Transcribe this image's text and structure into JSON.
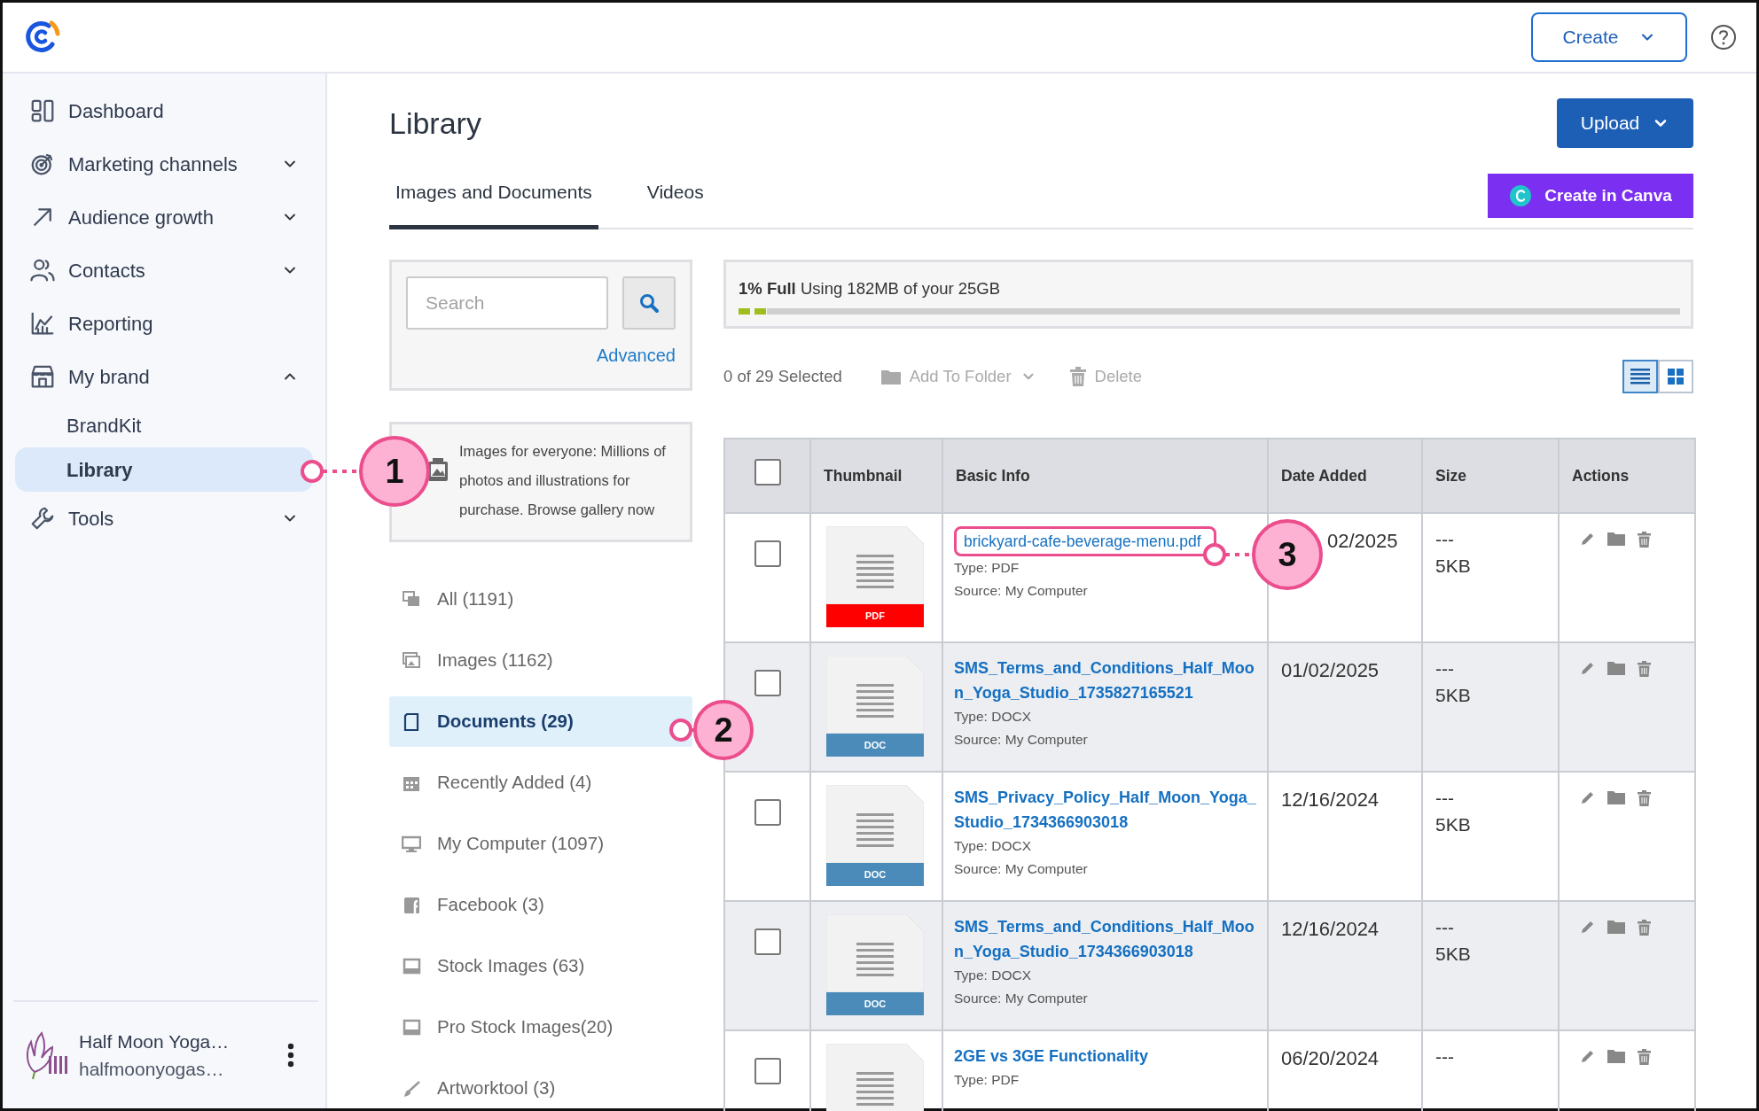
{
  "header": {
    "create_button": "Create"
  },
  "sidebar": {
    "items": [
      {
        "label": "Dashboard",
        "selected": false
      },
      {
        "label": "Marketing channels",
        "expanded": false,
        "selected": false
      },
      {
        "label": "Audience growth",
        "expanded": false,
        "selected": false
      },
      {
        "label": "Contacts",
        "expanded": false,
        "selected": false
      },
      {
        "label": "Reporting",
        "selected": false
      },
      {
        "label": "My brand",
        "expanded": true,
        "selected": false,
        "children": [
          {
            "label": "BrandKit",
            "selected": false
          },
          {
            "label": "Library",
            "selected": true
          }
        ]
      },
      {
        "label": "Tools",
        "expanded": false,
        "selected": false
      }
    ],
    "account": {
      "name": "Half Moon Yoga…",
      "email": "halfmoonyogas…"
    }
  },
  "page": {
    "title": "Library",
    "upload_button": "Upload",
    "canva_button": "Create in Canva",
    "tabs": [
      {
        "label": "Images and Documents",
        "selected": true
      },
      {
        "label": "Videos",
        "selected": false
      }
    ]
  },
  "search": {
    "placeholder": "Search",
    "advanced_link": "Advanced"
  },
  "promo": {
    "text": "Images for everyone: Millions of photos and illustrations for purchase.",
    "link": "Browse gallery now"
  },
  "filters": [
    {
      "label": "All (1191)",
      "selected": false
    },
    {
      "label": "Images (1162)",
      "selected": false
    },
    {
      "label": "Documents (29)",
      "selected": true
    },
    {
      "label": "Recently Added (4)",
      "selected": false
    },
    {
      "label": "My Computer (1097)",
      "selected": false
    },
    {
      "label": "Facebook (3)",
      "selected": false
    },
    {
      "label": "Stock Images (63)",
      "selected": false
    },
    {
      "label": "Pro Stock Images(20)",
      "selected": false
    },
    {
      "label": "Artworktool (3)",
      "selected": false
    }
  ],
  "storage": {
    "text": "**1% Full** Using 182MB of your 25GB",
    "level": 0.03
  },
  "toolbar": {
    "selected_count": "0 of 29 Selected",
    "add_to_folder": "Add To Folder",
    "delete": "Delete",
    "disabled": true,
    "views": [
      {
        "kind": "list",
        "selected": true
      },
      {
        "kind": "grid",
        "selected": false
      }
    ]
  },
  "table": {
    "select_all_checked": false,
    "columns": [
      "Thumbnail",
      "Basic Info",
      "Date Added",
      "Size",
      "Actions"
    ],
    "rows": [
      {
        "badge": "PDF",
        "color": "#ff0000",
        "name": "brickyard-cafe-beverage-menu.pdf",
        "outlined": true,
        "type": "Type: PDF",
        "source": "Source: My Computer",
        "date": "02/2025",
        "dimensions": "---",
        "size": "5KB",
        "checked": false
      },
      {
        "badge": "DOC",
        "color": "#4a8bba",
        "name": "SMS_Terms_and_Conditions_Half_Moon_Yoga_Studio_1735827165521",
        "outlined": false,
        "type": "Type: DOCX",
        "source": "Source: My Computer",
        "date": "01/02/2025",
        "dimensions": "---",
        "size": "5KB",
        "checked": false
      },
      {
        "badge": "DOC",
        "color": "#4a8bba",
        "name": "SMS_Privacy_Policy_Half_Moon_Yoga_Studio_1734366903018",
        "outlined": false,
        "type": "Type: DOCX",
        "source": "Source: My Computer",
        "date": "12/16/2024",
        "dimensions": "---",
        "size": "5KB",
        "checked": false
      },
      {
        "badge": "DOC",
        "color": "#4a8bba",
        "name": "SMS_Terms_and_Conditions_Half_Moon_Yoga_Studio_1734366903018",
        "outlined": false,
        "type": "Type: DOCX",
        "source": "Source: My Computer",
        "date": "12/16/2024",
        "dimensions": "---",
        "size": "5KB",
        "checked": false
      },
      {
        "name": "2GE vs 3GE Functionality",
        "outlined": false,
        "type": "Type: PDF",
        "date": "06/20/2024",
        "dimensions": "---",
        "checked": false
      }
    ]
  },
  "callouts": [
    {
      "label": "1"
    },
    {
      "label": "2"
    },
    {
      "label": "3"
    }
  ]
}
